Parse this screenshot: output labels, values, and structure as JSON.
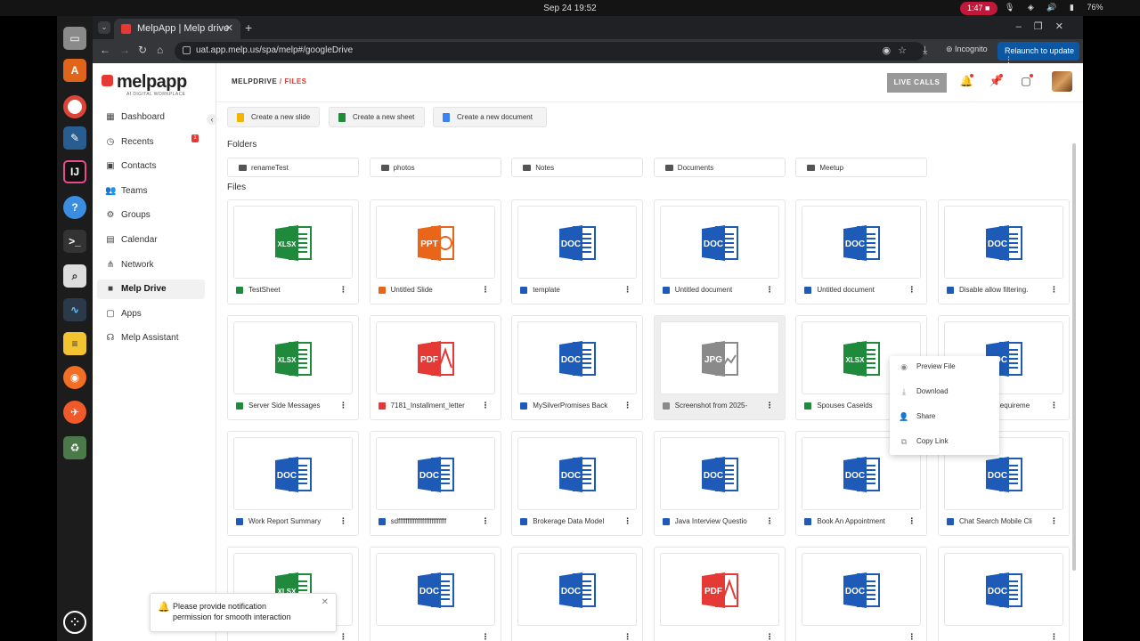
{
  "system": {
    "clock": "Sep 24  19:52",
    "recording": "1:47",
    "battery": "76%"
  },
  "browser": {
    "tab_title": "MelpApp | Melp drive",
    "url": "uat.app.melp.us/spa/melp#/googleDrive",
    "incognito": "Incognito",
    "relaunch": "Relaunch to update"
  },
  "logo": {
    "name": "melpapp",
    "tagline": "AI DIGITAL WORKPLACE"
  },
  "sidebar": {
    "items": [
      {
        "label": "Dashboard",
        "icon": "dashboard-icon"
      },
      {
        "label": "Recents",
        "icon": "clock-icon",
        "badge": "1"
      },
      {
        "label": "Contacts",
        "icon": "contacts-icon"
      },
      {
        "label": "Teams",
        "icon": "teams-icon"
      },
      {
        "label": "Groups",
        "icon": "groups-icon"
      },
      {
        "label": "Calendar",
        "icon": "calendar-icon"
      },
      {
        "label": "Network",
        "icon": "network-icon"
      },
      {
        "label": "Melp Drive",
        "icon": "folder-icon",
        "active": true
      },
      {
        "label": "Apps",
        "icon": "apps-icon"
      },
      {
        "label": "Melp Assistant",
        "icon": "headset-icon"
      }
    ]
  },
  "header": {
    "crumb_root": "MELPDRIVE",
    "crumb_sep": " / ",
    "crumb_current": "FILES",
    "live_calls": "LIVE CALLS"
  },
  "actions": [
    "Create a new slide",
    "Create a new sheet",
    "Create a new document"
  ],
  "folders_title": "Folders",
  "folders": [
    "renameTest",
    "photos",
    "Notes",
    "Documents",
    "Meetup"
  ],
  "files_title": "Files",
  "files": [
    {
      "name": "TestSheet",
      "type": "XLSX"
    },
    {
      "name": "Untitled Slide",
      "type": "PPT"
    },
    {
      "name": "template",
      "type": "DOC"
    },
    {
      "name": "Untitled document",
      "type": "DOC"
    },
    {
      "name": "Untitled document",
      "type": "DOC"
    },
    {
      "name": "Disable allow filtering.",
      "type": "DOC"
    },
    {
      "name": "Server Side Messages",
      "type": "XLSX"
    },
    {
      "name": "7181_Installment_letter",
      "type": "PDF"
    },
    {
      "name": "MySilverPromises Back",
      "type": "DOC"
    },
    {
      "name": "Screenshot from 2025-",
      "type": "JPG"
    },
    {
      "name": "Spouses Caselds",
      "type": "XLSX"
    },
    {
      "name": "Integration Requireme",
      "type": "DOC"
    },
    {
      "name": "Work Report Summary",
      "type": "DOC"
    },
    {
      "name": "sdffffffffffffffffffffffffff",
      "type": "DOC"
    },
    {
      "name": "Brokerage Data Model",
      "type": "DOC"
    },
    {
      "name": "Java Interview Questio",
      "type": "DOC"
    },
    {
      "name": "Book An Appointment",
      "type": "DOC"
    },
    {
      "name": "Chat Search Mobile Cli",
      "type": "DOC"
    },
    {
      "name": "",
      "type": "XLSX"
    },
    {
      "name": "",
      "type": "DOC"
    },
    {
      "name": "",
      "type": "DOC"
    },
    {
      "name": "",
      "type": "PDF"
    },
    {
      "name": "",
      "type": "DOC"
    },
    {
      "name": "",
      "type": "DOC"
    }
  ],
  "context_menu": [
    "Preview File",
    "Download",
    "Share",
    "Copy Link"
  ],
  "toast": {
    "line1": "Please provide notification",
    "line2": "permission for smooth interaction"
  },
  "colors": {
    "brand": "#e53935",
    "doc": "#1e5bb8",
    "xlsx": "#1f8a3b",
    "ppt": "#e8651a",
    "pdf": "#e53935",
    "jpg": "#8a8a8a"
  }
}
